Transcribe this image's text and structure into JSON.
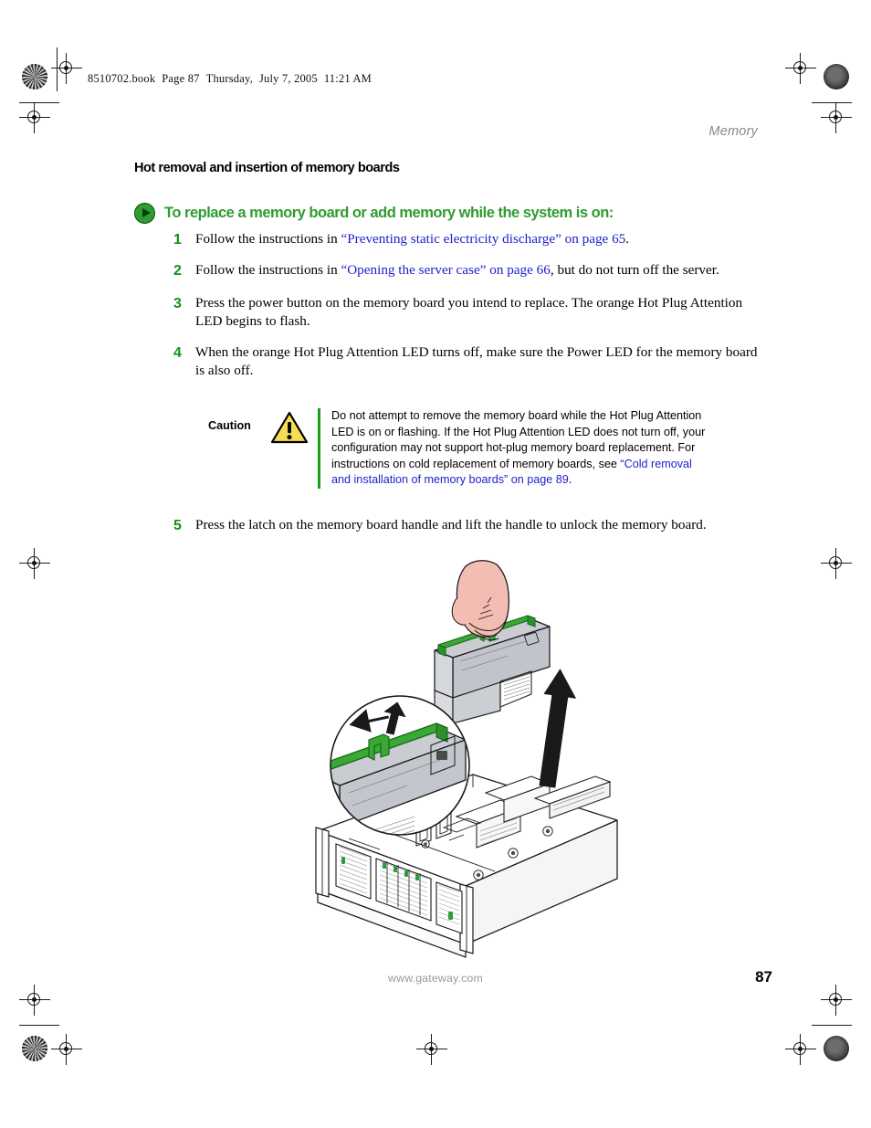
{
  "header": {
    "book_file": "8510702.book",
    "page_label": "Page 87",
    "weekday": "Thursday,",
    "date": "July 7, 2005",
    "time": "11:21 AM",
    "running_head": "Memory"
  },
  "section": {
    "title": "Hot removal and insertion of memory boards",
    "procedure_heading": "To replace a memory board or add memory while the system is on:"
  },
  "steps": [
    {
      "number": "1",
      "text_before": "Follow the instructions in ",
      "xref": "“Preventing static electricity discharge” on page 65",
      "text_after": "."
    },
    {
      "number": "2",
      "text_before": "Follow the instructions in ",
      "xref": "“Opening the server case” on page 66",
      "text_after": ", but do not turn off the server."
    },
    {
      "number": "3",
      "text_before": "Press the power button on the memory board you intend to replace. The orange Hot Plug Attention LED begins to flash.",
      "xref": "",
      "text_after": ""
    },
    {
      "number": "4",
      "text_before": "When the orange Hot Plug Attention LED turns off, make sure the Power LED for the memory board is also off.",
      "xref": "",
      "text_after": ""
    },
    {
      "number": "5",
      "text_before": "Press the latch on the memory board handle and lift the handle to unlock the memory board.",
      "xref": "",
      "text_after": ""
    }
  ],
  "caution": {
    "label": "Caution",
    "text_before": "Do not attempt to remove the memory board while the Hot Plug Attention LED is on or flashing. If the Hot Plug Attention LED does not turn off, your configuration may not support hot-plug memory board replacement. For instructions on cold replacement of memory boards, see ",
    "xref": "“Cold removal and installation of memory boards” on page 89",
    "text_after": "."
  },
  "figure": {
    "caption": "",
    "alt": "Hand lifting a memory board out of a rack server chassis, with a magnified circular inset showing the green latch and handle"
  },
  "footer": {
    "url": "www.gateway.com",
    "page_number": "87"
  },
  "colors": {
    "accent_green": "#2e9c2e",
    "step_green": "#159015",
    "link_blue": "#2020cc",
    "caution_yellow": "#f5dd55",
    "running_head_gray": "#8a8a8a",
    "footer_gray": "#9a9a9a",
    "hand_pink": "#f3bdb3",
    "chassis_gray": "#c9ccd1"
  }
}
